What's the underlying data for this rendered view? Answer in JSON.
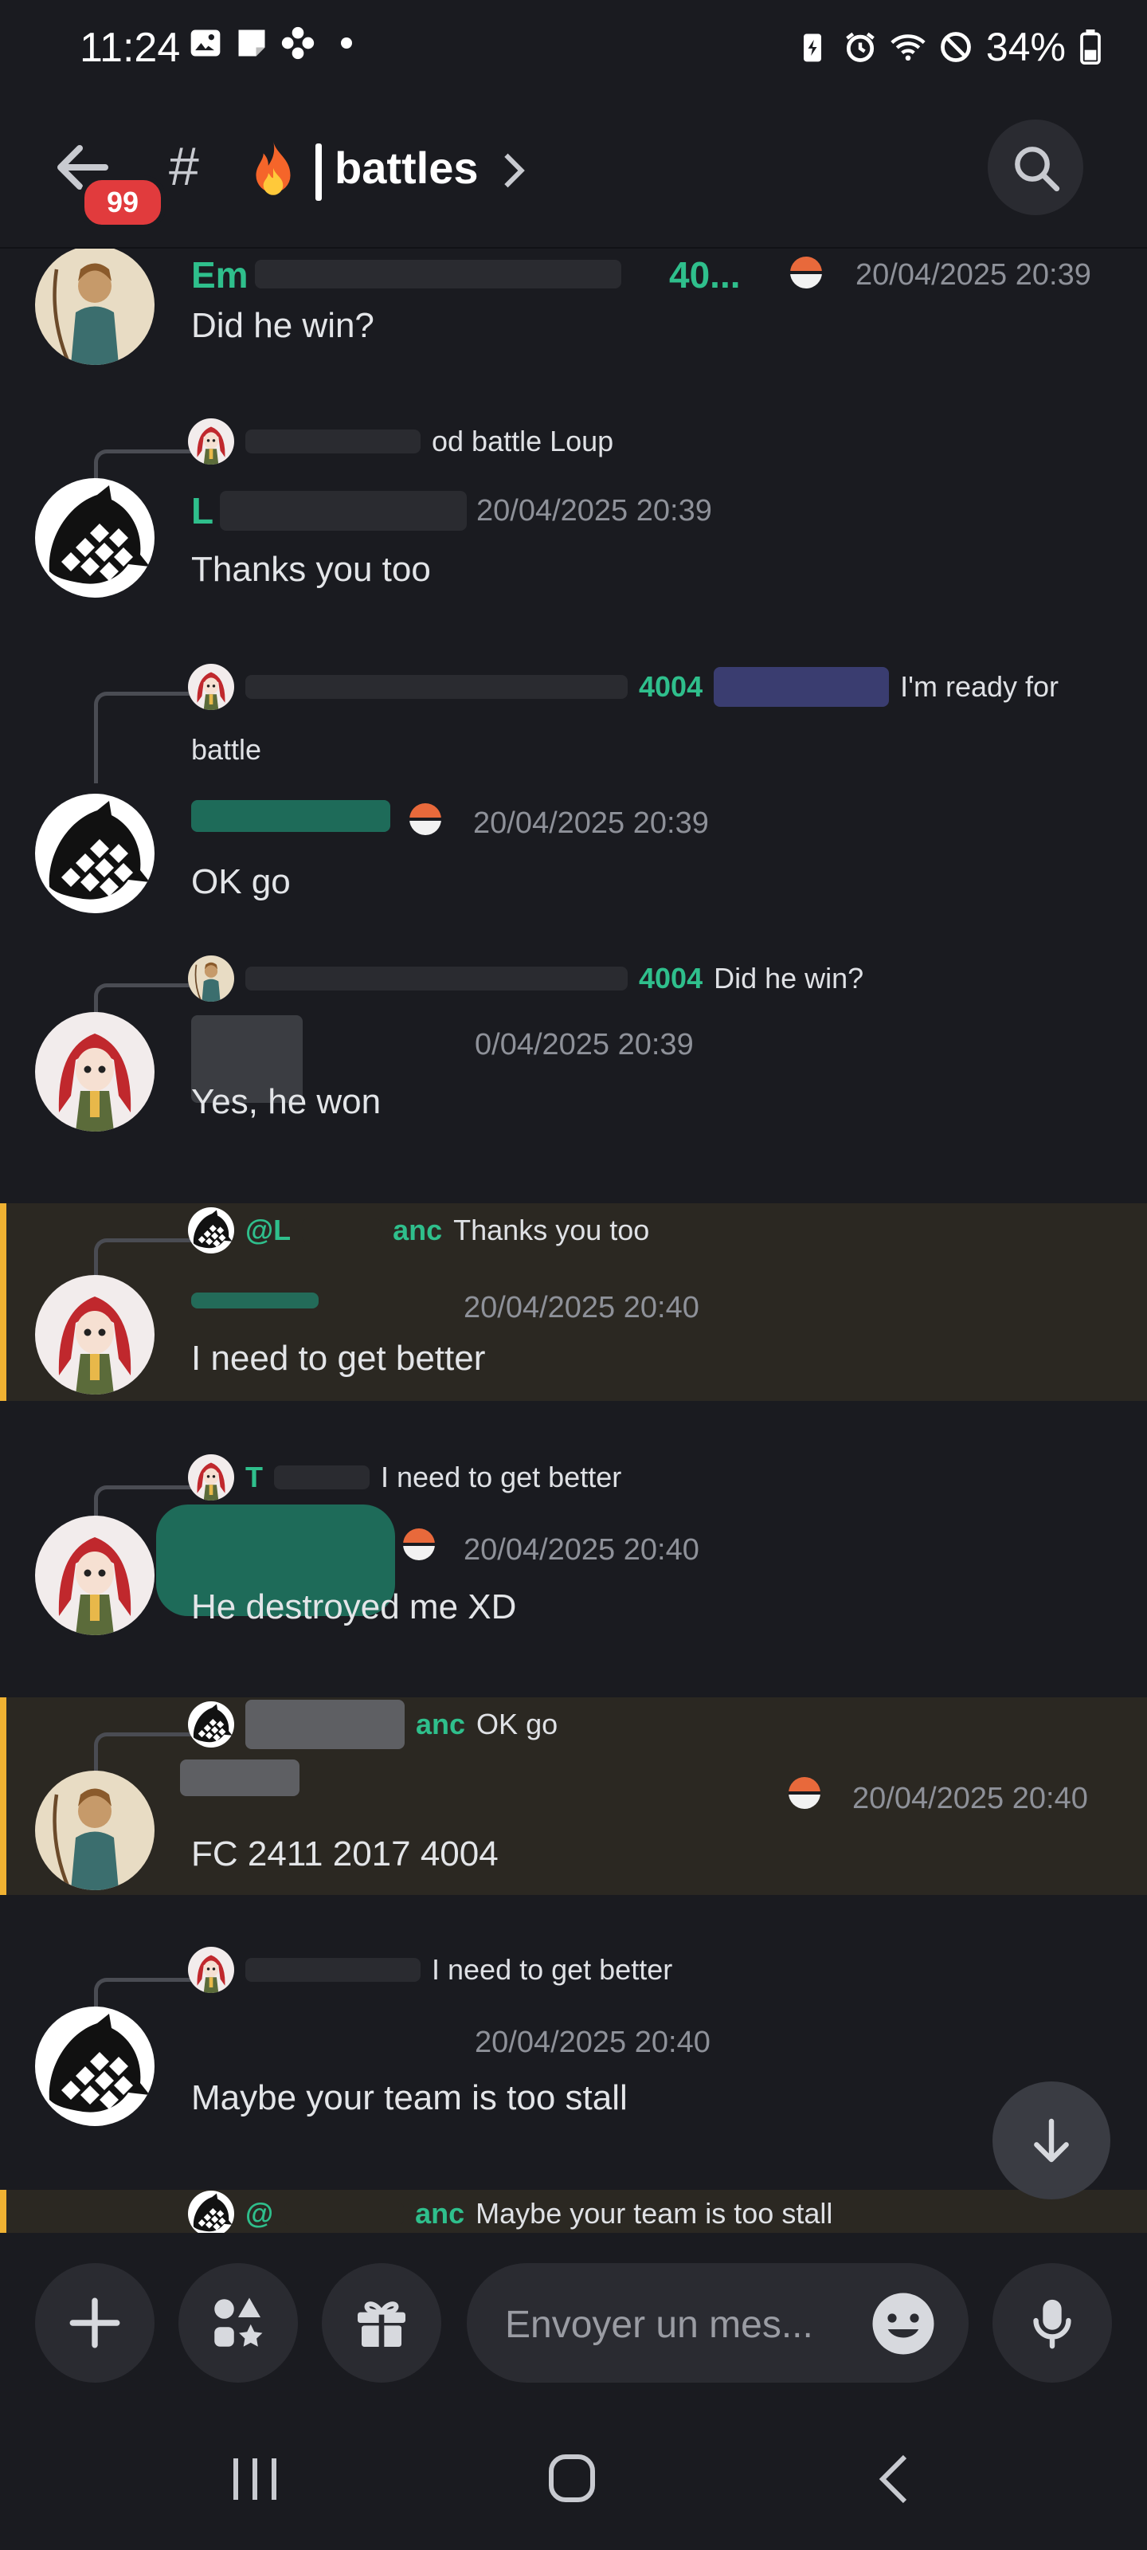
{
  "status_bar": {
    "time": "11:24",
    "battery": "34%"
  },
  "header": {
    "badge": "99",
    "hash": "#",
    "channel_name": "battles"
  },
  "messages": [
    {
      "author": "Em",
      "author_tail": "40...",
      "timestamp": "20/04/2025 20:39",
      "content": "Did he win?"
    },
    {
      "reply_text": "od battle Loup",
      "author": "L",
      "timestamp": "20/04/2025 20:39",
      "content": "Thanks you too"
    },
    {
      "reply_user": "4004",
      "reply_text": "I'm ready for",
      "reply_text2": "battle",
      "timestamp": "20/04/2025 20:39",
      "content": "OK go"
    },
    {
      "reply_user": "4004",
      "reply_text": "Did he win?",
      "timestamp": "0/04/2025 20:39",
      "content": "Yes, he won"
    },
    {
      "reply_user": "@L",
      "reply_user_tail": "anc",
      "reply_text": "Thanks you too",
      "timestamp": "20/04/2025 20:40",
      "content": "I need to get better"
    },
    {
      "reply_user": "T",
      "reply_text": "I need to get better",
      "timestamp": "20/04/2025 20:40",
      "content": "He destroyed me XD"
    },
    {
      "reply_user_tail": "anc",
      "reply_text": "OK go",
      "timestamp": "20/04/2025 20:40",
      "content": "FC 2411 2017 4004"
    },
    {
      "reply_text": "I need to get better",
      "timestamp": "20/04/2025 20:40",
      "content": "Maybe your team is too stall"
    },
    {
      "reply_user": "@",
      "reply_user_tail": "anc",
      "reply_text": "Maybe your team is too stall"
    }
  ],
  "composer": {
    "placeholder": "Envoyer un mes..."
  },
  "icons": [
    "back-arrow-icon",
    "search-icon",
    "fire-icon",
    "chevron-right-icon",
    "pokeball-icon",
    "arrow-down-icon",
    "plus-icon",
    "apps-icon",
    "gift-icon",
    "emoji-icon",
    "microphone-icon",
    "recents-icon",
    "home-icon",
    "nav-back-icon"
  ],
  "colors": {
    "background": "#1a1b20",
    "username_teal": "#2fbf8c",
    "highlight": "#2b2822",
    "highlight_bar": "#f0b232",
    "badge": "#e13b3d"
  }
}
